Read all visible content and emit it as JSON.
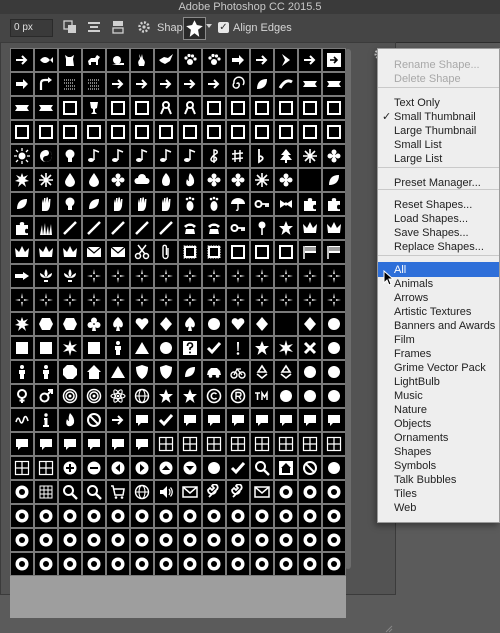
{
  "window": {
    "title": "Adobe Photoshop CC 2015.5"
  },
  "options_bar": {
    "radius_value": "0 px",
    "shape_label": "Shape:",
    "align_edges_label": "Align Edges",
    "align_edges_checked": true
  },
  "shape_picker": {
    "selected_shape_icon": "ornate-shape-icon",
    "grid_columns": 14,
    "grid_rows": 22,
    "shape_icons": [
      "arrow",
      "fish",
      "cat",
      "dog",
      "snail",
      "rabbit",
      "bird",
      "paw",
      "paw",
      "arrow-right",
      "arrow",
      "chevron-right",
      "arrow",
      "arrow-box",
      "arrow-right",
      "arrow-curve",
      "texture",
      "texture",
      "arrow",
      "arrow",
      "arrow",
      "arrow",
      "arrow",
      "swirl",
      "leaf",
      "curve",
      "banner",
      "banner",
      "banner",
      "banner",
      "frame",
      "trophy",
      "frame",
      "frame",
      "ribbon",
      "ribbon",
      "frame",
      "frame",
      "frame",
      "frame",
      "frame",
      "frame",
      "frame",
      "frame",
      "frame",
      "frame",
      "frame",
      "frame",
      "frame",
      "frame",
      "frame",
      "frame",
      "frame",
      "frame",
      "frame",
      "frame",
      "sun",
      "yin-yang",
      "bulb",
      "note",
      "note",
      "note",
      "note",
      "note",
      "clef",
      "sharp",
      "flat",
      "tree",
      "snowflake",
      "flower",
      "splat",
      "snowflake",
      "drop",
      "drop",
      "flower",
      "cloud",
      "flame",
      "fire",
      "flower",
      "flower",
      "snowflake",
      "flower",
      "moon",
      "leaf",
      "leaf",
      "hand",
      "bulb",
      "leaf",
      "hand",
      "hand",
      "hand",
      "foot",
      "foot",
      "umbrella",
      "key",
      "bow",
      "puzzle",
      "puzzle",
      "puzzle",
      "grass",
      "line",
      "line",
      "line",
      "line",
      "line",
      "phone",
      "phone",
      "key",
      "pin",
      "star",
      "crown",
      "crown",
      "crown",
      "crown",
      "crown",
      "envelope",
      "envelope",
      "scissors",
      "clip",
      "stamp",
      "stamp",
      "frame",
      "frame",
      "frame",
      "flag",
      "flag",
      "pointer",
      "fleur",
      "fleur",
      "ornament",
      "ornament",
      "ornament",
      "ornament",
      "ornament",
      "ornament",
      "ornament",
      "ornament",
      "ornament",
      "ornament",
      "ornament",
      "ornament",
      "ornament",
      "ornament",
      "ornament",
      "ornament",
      "ornament",
      "ornament",
      "ornament",
      "ornament",
      "ornament",
      "ornament",
      "ornament",
      "ornament",
      "ornament",
      "splat",
      "hexagon",
      "hexagon",
      "club",
      "spade",
      "heart",
      "diamond",
      "spade",
      "circle",
      "heart",
      "diamond",
      "moon",
      "diamond",
      "circle",
      "square",
      "square",
      "burst",
      "square",
      "person",
      "triangle",
      "circle",
      "question",
      "check",
      "exclaim",
      "star",
      "burst",
      "x",
      "circle",
      "person",
      "person",
      "octagon",
      "house",
      "triangle",
      "shield",
      "shield",
      "leaf",
      "car",
      "bike",
      "recycle",
      "recycle",
      "circle",
      "circle",
      "female",
      "male",
      "target",
      "target",
      "atom",
      "globe",
      "star",
      "star",
      "copyright",
      "registered",
      "trademark",
      "circle",
      "circle",
      "circle",
      "scribble",
      "info",
      "fire",
      "no",
      "arrow",
      "bubble",
      "check",
      "bubble",
      "bubble",
      "bubble",
      "bubble",
      "bubble",
      "bubble",
      "bubble",
      "bubble",
      "bubble",
      "bubble",
      "bubble",
      "bubble",
      "bubble",
      "tile",
      "tile",
      "tile",
      "tile",
      "tile",
      "tile",
      "tile",
      "tile",
      "tile",
      "tile",
      "plus",
      "minus",
      "prev",
      "next",
      "up",
      "down",
      "circle",
      "check",
      "search",
      "home",
      "no",
      "circle",
      "web",
      "grid",
      "search",
      "search",
      "cart",
      "globe",
      "speaker",
      "mail",
      "tools",
      "tools",
      "mail",
      "web",
      "web",
      "web",
      "web",
      "web",
      "web",
      "web",
      "web",
      "web",
      "web",
      "web",
      "web",
      "web",
      "web",
      "web",
      "web",
      "web",
      "web",
      "web",
      "web",
      "web",
      "web",
      "web",
      "web",
      "web",
      "web",
      "web",
      "web",
      "web",
      "web",
      "web",
      "web",
      "web",
      "web",
      "web",
      "web",
      "web",
      "web",
      "web",
      "web",
      "web",
      "web",
      "web",
      "web",
      "web"
    ]
  },
  "menu": {
    "items": [
      {
        "label": "Rename Shape...",
        "disabled": true
      },
      {
        "label": "Delete Shape",
        "disabled": true
      },
      {
        "label": "Text Only"
      },
      {
        "label": "Small Thumbnail",
        "checked": true
      },
      {
        "label": "Large Thumbnail"
      },
      {
        "label": "Small List"
      },
      {
        "label": "Large List"
      },
      {
        "label": "Preset Manager..."
      },
      {
        "label": "Reset Shapes..."
      },
      {
        "label": "Load Shapes..."
      },
      {
        "label": "Save Shapes..."
      },
      {
        "label": "Replace Shapes..."
      },
      {
        "label": "All",
        "selected": true
      },
      {
        "label": "Animals"
      },
      {
        "label": "Arrows"
      },
      {
        "label": "Artistic Textures"
      },
      {
        "label": "Banners and Awards"
      },
      {
        "label": "Film"
      },
      {
        "label": "Frames"
      },
      {
        "label": "Grime Vector Pack"
      },
      {
        "label": "LightBulb"
      },
      {
        "label": "Music"
      },
      {
        "label": "Nature"
      },
      {
        "label": "Objects"
      },
      {
        "label": "Ornaments"
      },
      {
        "label": "Shapes"
      },
      {
        "label": "Symbols"
      },
      {
        "label": "Talk Bubbles"
      },
      {
        "label": "Tiles"
      },
      {
        "label": "Web"
      }
    ]
  },
  "colors": {
    "menu_highlight": "#2e6fd9",
    "picker_bg": "#535353",
    "shape_cell_bg": "#000000",
    "shape_fill": "#ffffff"
  }
}
